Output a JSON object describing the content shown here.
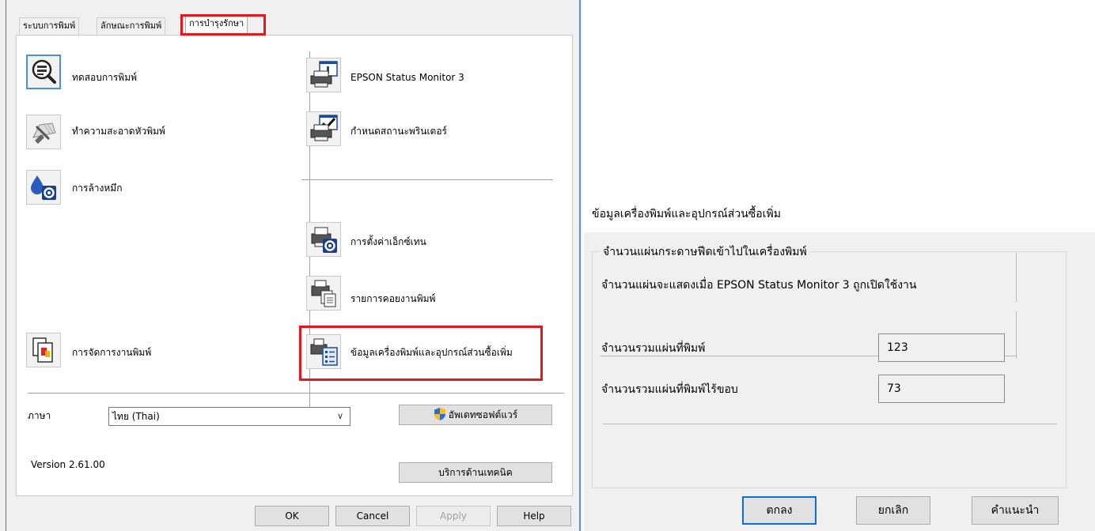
{
  "tabs": [
    {
      "label": "ระบบการพิมพ์"
    },
    {
      "label": "ลักษณะการพิมพ์"
    },
    {
      "label": "การบำรุงรักษา"
    }
  ],
  "active_tab": "การบำรุงรักษา",
  "highlight_color": "#e8151b",
  "tools_left": [
    {
      "label": "ทดสอบการพิมพ์",
      "icon": "nozzle-check-icon"
    },
    {
      "label": "ทำความสะอาดหัวพิมพ์",
      "icon": "head-cleaning-icon"
    },
    {
      "label": "การล้างหมึก",
      "icon": "ink-flush-icon"
    },
    {
      "label": "การจัดการงานพิมพ์",
      "icon": "job-arranger-icon"
    }
  ],
  "tools_right": [
    {
      "label": "EPSON Status Monitor 3",
      "icon": "status-monitor-icon"
    },
    {
      "label": "กำหนดสถานะพรินเตอร์",
      "icon": "monitoring-preferences-icon"
    },
    {
      "label": "การตั้งค่าเอ็กซ์เทน",
      "icon": "extended-settings-icon"
    },
    {
      "label": "รายการคอยงานพิมพ์",
      "icon": "print-queue-icon"
    },
    {
      "label": "ข้อมูลเครื่องพิมพ์และอุปกรณ์ส่วนซื้อเพิ่ม",
      "icon": "printer-info-icon"
    }
  ],
  "language": {
    "label": "ภาษา",
    "value": "ไทย (Thai)"
  },
  "buttons": {
    "software_update": "อัพเดทซอฟต์แวร์",
    "technical_support": "บริการด้านเทคนิค",
    "ok": "OK",
    "cancel": "Cancel",
    "apply": "Apply",
    "help": "Help"
  },
  "version": "Version 2.61.00",
  "info_dialog": {
    "title": "ข้อมูลเครื่องพิมพ์และอุปกรณ์ส่วนซื้อเพิ่ม",
    "group_label": "จำนวนแผ่นกระดาษฟีดเข้าไปในเครื่องพิมพ์",
    "info_text": "จำนวนแผ่นจะแสดงเมื่อ EPSON Status Monitor 3 ถูกเปิดใช้งาน",
    "total_label": "จำนวนรวมแผ่นที่พิมพ์",
    "total_value": "123",
    "borderless_label": "จำนวนรวมแผ่นที่พิมพ์ไร้ขอบ",
    "borderless_value": "73",
    "buttons": {
      "ok": "ตกลง",
      "cancel": "ยกเลิก",
      "help": "คำแนะนำ"
    }
  }
}
